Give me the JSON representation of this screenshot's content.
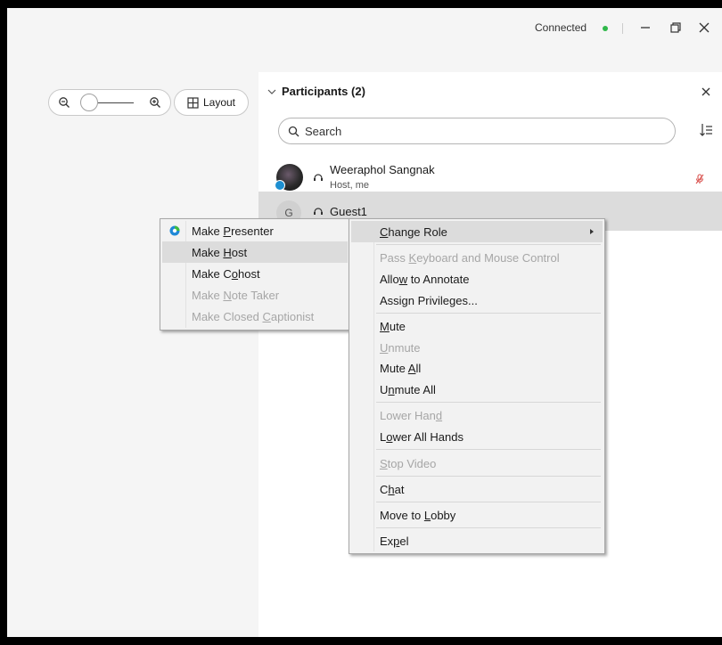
{
  "titlebar": {
    "status": "Connected",
    "status_color": "#2fb84a",
    "minimize_icon": "minimize-icon",
    "restore_icon": "restore-icon",
    "close_icon": "close-icon"
  },
  "toolbar": {
    "zoom_out_icon": "zoom-out-icon",
    "zoom_in_icon": "zoom-in-icon",
    "zoom_level": 0,
    "layout_label": "Layout",
    "layout_icon": "grid-icon"
  },
  "participants": {
    "title": "Participants (2)",
    "search_placeholder": "Search",
    "list": [
      {
        "name": "Weeraphol Sangnak",
        "subtitle": "Host, me",
        "muted": true
      },
      {
        "initial": "G",
        "name": "Guest1",
        "selected": true
      }
    ]
  },
  "submenu": {
    "items": [
      {
        "label": "Make Presenter",
        "mnemonic": "P",
        "icon": "presenter-ball-icon",
        "disabled": false
      },
      {
        "label": "Make Host",
        "mnemonic": "H",
        "disabled": false,
        "highlighted": true
      },
      {
        "label": "Make Cohost",
        "mnemonic": "o",
        "disabled": false
      },
      {
        "label": "Make Note Taker",
        "mnemonic": "N",
        "disabled": true
      },
      {
        "label": "Make Closed Captionist",
        "mnemonic": "C",
        "disabled": true
      }
    ]
  },
  "context_menu": {
    "items": [
      {
        "label": "Change Role",
        "mnemonic": "C",
        "disabled": false,
        "highlighted": true,
        "submenu": true
      },
      {
        "label": "Pass Keyboard and Mouse Control",
        "mnemonic": "K",
        "disabled": true
      },
      {
        "label": "Allow to Annotate",
        "mnemonic": "w",
        "disabled": false
      },
      {
        "label": "Assign Privileges...",
        "mnemonic": "v",
        "disabled": false
      },
      {
        "label": "Mute",
        "mnemonic": "M",
        "disabled": false
      },
      {
        "label": "Unmute",
        "mnemonic": "U",
        "disabled": true
      },
      {
        "label": "Mute All",
        "mnemonic": "A",
        "disabled": false
      },
      {
        "label": "Unmute All",
        "mnemonic": "n",
        "disabled": false
      },
      {
        "label": "Lower Hand",
        "mnemonic": "d",
        "disabled": true
      },
      {
        "label": "Lower All Hands",
        "mnemonic": "o",
        "disabled": false
      },
      {
        "label": "Stop Video",
        "mnemonic": "S",
        "disabled": true
      },
      {
        "label": "Chat",
        "mnemonic": "h",
        "disabled": false
      },
      {
        "label": "Move to Lobby",
        "mnemonic": "L",
        "disabled": false
      },
      {
        "label": "Expel",
        "mnemonic": "p",
        "disabled": false
      }
    ]
  }
}
